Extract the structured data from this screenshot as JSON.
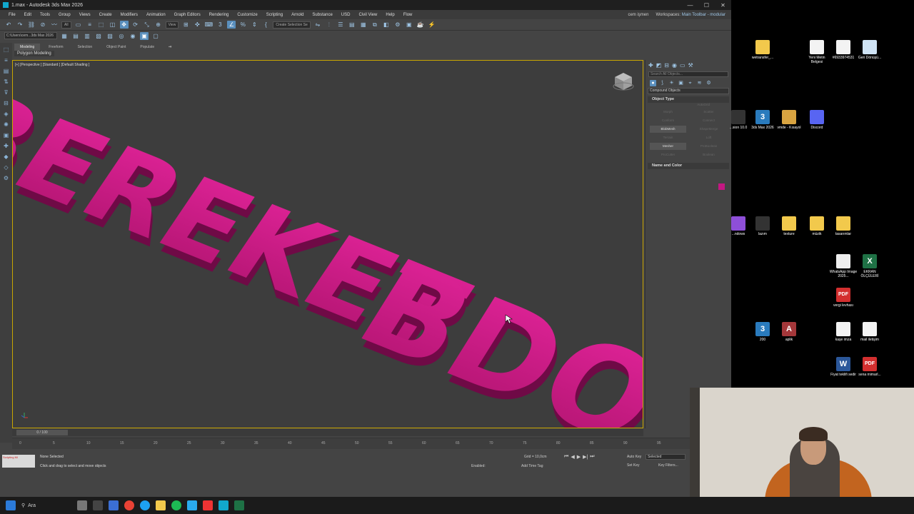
{
  "window": {
    "title": "1.max - Autodesk 3ds Max 2026",
    "controls": [
      "—",
      "☐",
      "✕"
    ]
  },
  "menu": {
    "items": [
      "File",
      "Edit",
      "Tools",
      "Group",
      "Views",
      "Create",
      "Modifiers",
      "Animation",
      "Graph Editors",
      "Rendering",
      "Customize",
      "Scripting",
      "Arnold",
      "Substance",
      "USD",
      "Civil View",
      "Help",
      "Flow"
    ],
    "user": "cem işmen",
    "workspaces_label": "Workspaces:",
    "workspace": "Main Toolbar - modular"
  },
  "toolbar": {
    "filter_dropdown": "All",
    "view_dropdown": "View",
    "selection_set": "Create Selection Se",
    "path": "C:\\Users\\cem...3ds Max 2026"
  },
  "ribbon": {
    "tabs": [
      "Modeling",
      "Freeform",
      "Selection",
      "Object Paint",
      "Populate"
    ],
    "active_tab": "Modeling",
    "sub_label": "Polygon Modeling"
  },
  "viewport": {
    "label": "[+] [Perspective ] [Standard ] [Default Shading ]",
    "scene_text": "BEREKET BDO",
    "text_color": "#c41782"
  },
  "command_panel": {
    "search_placeholder": "Search All Objects...",
    "category": "Compound Objects",
    "object_type_title": "Object Type",
    "autogrid_label": "AutoGrid",
    "buttons": [
      {
        "label": "Morph",
        "enabled": false
      },
      {
        "label": "Scatter",
        "enabled": false
      },
      {
        "label": "Conform",
        "enabled": false
      },
      {
        "label": "Connect",
        "enabled": false
      },
      {
        "label": "BlobMesh",
        "enabled": true
      },
      {
        "label": "ShapeMerge",
        "enabled": false
      },
      {
        "label": "Terrain",
        "enabled": false
      },
      {
        "label": "Loft",
        "enabled": false
      },
      {
        "label": "Mesher",
        "enabled": true
      },
      {
        "label": "ProBoolean",
        "enabled": false
      },
      {
        "label": "ProCutter",
        "enabled": false
      },
      {
        "label": "Boolean",
        "enabled": false
      }
    ],
    "name_color_title": "Name and Color",
    "swatch_color": "#c41782"
  },
  "timeline": {
    "slider_label": "0 / 100",
    "ticks": [
      "0",
      "5",
      "10",
      "15",
      "20",
      "25",
      "30",
      "35",
      "40",
      "45",
      "50",
      "55",
      "60",
      "65",
      "70",
      "75",
      "80",
      "85",
      "90",
      "95"
    ]
  },
  "status": {
    "selection": "None Selected",
    "prompt": "Click and drag to select and move objects",
    "maxscript": "Scripting Mi",
    "grid": "Grid = 10,0cm",
    "add_time_tag": "Add Time Tag",
    "enabled_label": "Enabled:",
    "auto_key": "Auto Key",
    "set_key": "Set Key",
    "selected": "Selected",
    "key_filters": "Key Filters...",
    "x_label": "X:",
    "z_label": "Z:"
  },
  "desktop": {
    "icons": [
      {
        "label": "wetransfer_...",
        "type": "folder"
      },
      {
        "label": "Yeni Metin Belgesi",
        "type": "doc"
      },
      {
        "label": "#6933974531",
        "type": "doc"
      },
      {
        "label": "Geri Dönüşü...",
        "type": "bin"
      },
      {
        "label": "...sion 10.0",
        "type": "dark"
      },
      {
        "label": "3ds Max 2026",
        "type": "max"
      },
      {
        "label": "vmde - Kısayol",
        "type": "green"
      },
      {
        "label": "Discord",
        "type": "discord"
      },
      {
        "label": "...ndows",
        "type": "purple"
      },
      {
        "label": "lazım",
        "type": "dark"
      },
      {
        "label": "texture",
        "type": "folder"
      },
      {
        "label": "müzik",
        "type": "folder"
      },
      {
        "label": "tasarımlar",
        "type": "folder"
      },
      {
        "label": "WhatsApp Image 2025...",
        "type": "whats"
      },
      {
        "label": "EKRAN ÖLÇÜLERİ",
        "type": "excel"
      },
      {
        "label": "vergi levhası",
        "type": "pdf"
      },
      {
        "label": "200",
        "type": "max"
      },
      {
        "label": "aplik",
        "type": "access"
      },
      {
        "label": "kaşe imza",
        "type": "doc"
      },
      {
        "label": "mail iletişim",
        "type": "doc"
      },
      {
        "label": "Fiyat teklifi sedir",
        "type": "word"
      },
      {
        "label": "sena mimarl...",
        "type": "pdf"
      }
    ]
  },
  "taskbar": {
    "search_label": "Ara"
  }
}
